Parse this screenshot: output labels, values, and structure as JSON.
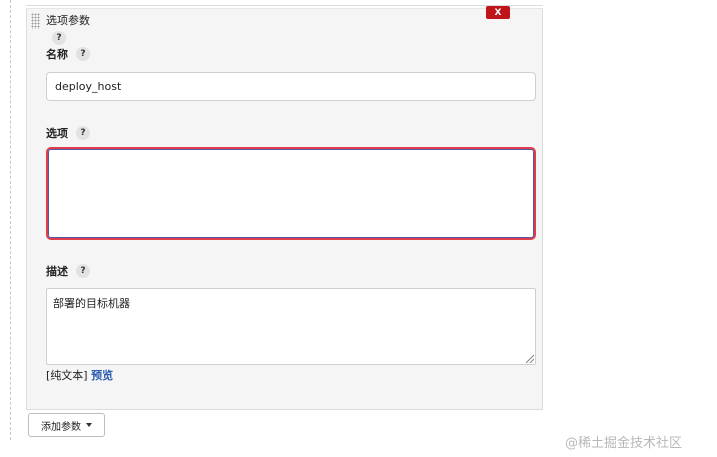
{
  "section": {
    "title": "选项参数",
    "close_label": "X"
  },
  "help_glyph": "?",
  "fields": {
    "name": {
      "label": "名称",
      "value": "deploy_host"
    },
    "choices": {
      "label": "选项",
      "value": ""
    },
    "description": {
      "label": "描述",
      "value": "部署的目标机器",
      "format_prefix": "[纯文本]",
      "preview_label": "预览"
    }
  },
  "add_param_button": {
    "label": "添加参数"
  },
  "watermark": "@稀土掘金技术社区",
  "colors": {
    "close_button": "#c0141b",
    "focus_border": "#e03c49",
    "preview_link": "#2a5db0",
    "panel_bg": "#f5f5f5"
  }
}
